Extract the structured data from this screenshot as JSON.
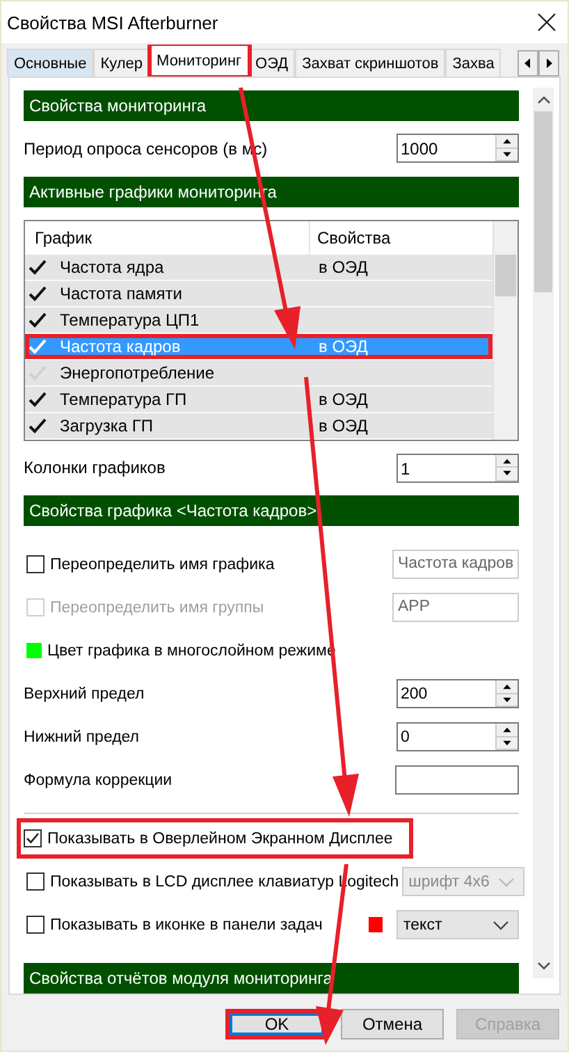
{
  "window": {
    "title": "Свойства MSI Afterburner"
  },
  "tabs": [
    {
      "label": "Основные",
      "selected": false,
      "hover": true,
      "highlighted": false
    },
    {
      "label": "Кулер",
      "selected": false,
      "hover": false,
      "highlighted": false
    },
    {
      "label": "Мониторинг",
      "selected": true,
      "hover": false,
      "highlighted": true
    },
    {
      "label": "ОЭД",
      "selected": false,
      "hover": false,
      "highlighted": false
    },
    {
      "label": "Захват скриншотов",
      "selected": false,
      "hover": false,
      "highlighted": false
    },
    {
      "label": "Захва",
      "selected": false,
      "hover": false,
      "highlighted": false
    }
  ],
  "monitoring_properties": {
    "header": "Свойства мониторинга",
    "poll_period": {
      "label": "Период опроса сенсоров (в мс)",
      "value": "1000"
    }
  },
  "active_graphs": {
    "header": "Активные графики мониторинга",
    "columns": [
      "График",
      "Свойства"
    ],
    "rows": [
      {
        "checked": true,
        "name": "Частота ядра",
        "properties": "в ОЭД",
        "selected": false,
        "highlighted": false
      },
      {
        "checked": true,
        "name": "Частота памяти",
        "properties": "",
        "selected": false,
        "highlighted": false
      },
      {
        "checked": true,
        "name": "Температура ЦП1",
        "properties": "",
        "selected": false,
        "highlighted": false
      },
      {
        "checked": true,
        "name": "Частота кадров",
        "properties": "в ОЭД",
        "selected": true,
        "highlighted": true
      },
      {
        "checked": false,
        "name": "Энергопотребление",
        "properties": "",
        "selected": false,
        "highlighted": false
      },
      {
        "checked": true,
        "name": "Температура ГП",
        "properties": "в ОЭД",
        "selected": false,
        "highlighted": false
      },
      {
        "checked": true,
        "name": "Загрузка ГП",
        "properties": "в ОЭД",
        "selected": false,
        "highlighted": false
      }
    ],
    "graph_columns": {
      "label": "Колонки графиков",
      "value": "1"
    }
  },
  "graph_properties": {
    "header": "Свойства графика <Частота кадров>",
    "items": [
      {
        "kind": "checkbox",
        "label": "Переопределить имя графика",
        "checked": false,
        "disabled": false,
        "highlighted": false,
        "field": {
          "value": "Частота кадров"
        }
      },
      {
        "kind": "checkbox",
        "label": "Переопределить имя группы",
        "checked": false,
        "disabled": true,
        "highlighted": false,
        "field": {
          "value": "APP"
        }
      },
      {
        "kind": "color",
        "label": "Цвет графика в многослойном режиме",
        "color": "#00ff00"
      },
      {
        "kind": "spin",
        "label": "Верхний предел",
        "value": "200"
      },
      {
        "kind": "spin",
        "label": "Нижний предел",
        "value": "0"
      },
      {
        "kind": "text",
        "label": "Формула коррекции",
        "value": ""
      },
      {
        "kind": "separator"
      },
      {
        "kind": "checkbox",
        "label": "Показывать в Оверлейном Экранном Дисплее",
        "checked": true,
        "disabled": false,
        "highlighted": true
      },
      {
        "kind": "checkbox",
        "label": "Показывать в LCD дисплее клавиатур Logitech",
        "checked": false,
        "disabled": false,
        "highlighted": false,
        "select": {
          "value": "шрифт 4x6",
          "disabled": true
        }
      },
      {
        "kind": "checkbox",
        "label": "Показывать в иконке в панели задач",
        "checked": false,
        "disabled": false,
        "highlighted": false,
        "color": "#ff0000",
        "select": {
          "value": "текст",
          "disabled": false
        }
      }
    ]
  },
  "reports_header": "Свойства отчётов модуля мониторинга",
  "buttons": [
    {
      "label": "OK",
      "default": true,
      "disabled": false,
      "highlighted": true
    },
    {
      "label": "Отмена",
      "default": false,
      "disabled": false,
      "highlighted": false
    },
    {
      "label": "Справка",
      "default": false,
      "disabled": true,
      "highlighted": false
    }
  ]
}
